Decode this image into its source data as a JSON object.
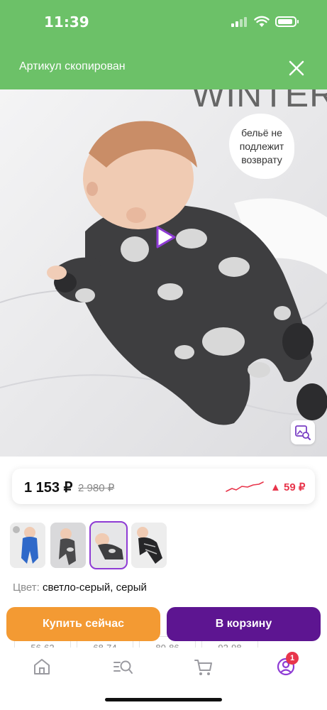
{
  "status_bar": {
    "time": "11:39",
    "icons": [
      "cellular-signal-icon",
      "wifi-icon",
      "battery-icon"
    ]
  },
  "toast": {
    "message": "Артикул скопирован",
    "close_icon": "close-icon"
  },
  "product_image": {
    "brand_text": "WINTER",
    "bubble_text": "бельё не подлежит возврату",
    "icons": [
      "play-icon",
      "image-search-icon"
    ]
  },
  "price": {
    "current": "1 153 ₽",
    "old": "2 980 ₽",
    "change": "▲ 59 ₽",
    "colors": {
      "accent_red": "#e8354b"
    }
  },
  "gallery": {
    "thumbnails": [
      {
        "alt": "Синий комбинезон",
        "selected": false
      },
      {
        "alt": "Серый комбинезон",
        "selected": false
      },
      {
        "alt": "Малыш в комбинезоне",
        "selected": true
      },
      {
        "alt": "Чёрный комбинезон",
        "selected": false
      }
    ]
  },
  "color": {
    "label": "Цвет:",
    "value": "светло-серый, серый"
  },
  "sizes": [
    "56-62",
    "68-74",
    "80-86",
    "92-98"
  ],
  "actions": {
    "buy_now": "Купить сейчас",
    "add_to_cart": "В корзину",
    "colors": {
      "buy_now_bg": "#f39a33",
      "cart_bg": "#5d1591"
    }
  },
  "bottom_nav": {
    "items": [
      "home-icon",
      "catalog-search-icon",
      "cart-icon",
      "profile-icon"
    ],
    "profile_badge": "1"
  },
  "theme": {
    "toast_bg": "#6cc168"
  }
}
